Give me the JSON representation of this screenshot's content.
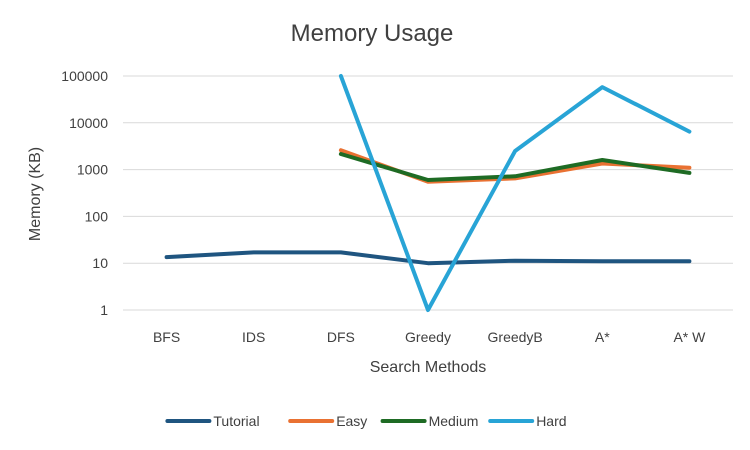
{
  "chart_data": {
    "type": "line",
    "title": "Memory Usage",
    "xlabel": "Search Methods",
    "ylabel": "Memory (KB)",
    "yscale": "log",
    "ylim": [
      1,
      100000
    ],
    "yticks": [
      "1",
      "10",
      "100",
      "1000",
      "10000",
      "100000"
    ],
    "categories": [
      "BFS",
      "IDS",
      "DFS",
      "Greedy",
      "GreedyB",
      "A*",
      "A* W"
    ],
    "grid": "horizontal",
    "legend_position": "bottom",
    "series": [
      {
        "name": "Tutorial",
        "color": "#1f5580",
        "values": [
          13.5,
          17,
          17,
          10,
          11.3,
          11,
          11
        ]
      },
      {
        "name": "Easy",
        "color": "#e97132",
        "values": [
          null,
          null,
          2600,
          550,
          650,
          1350,
          1100
        ]
      },
      {
        "name": "Medium",
        "color": "#1e6b24",
        "values": [
          null,
          null,
          2150,
          600,
          720,
          1600,
          850
        ]
      },
      {
        "name": "Hard",
        "color": "#28a4d6",
        "values": [
          null,
          null,
          100000,
          1,
          2500,
          58000,
          6500
        ]
      }
    ]
  }
}
